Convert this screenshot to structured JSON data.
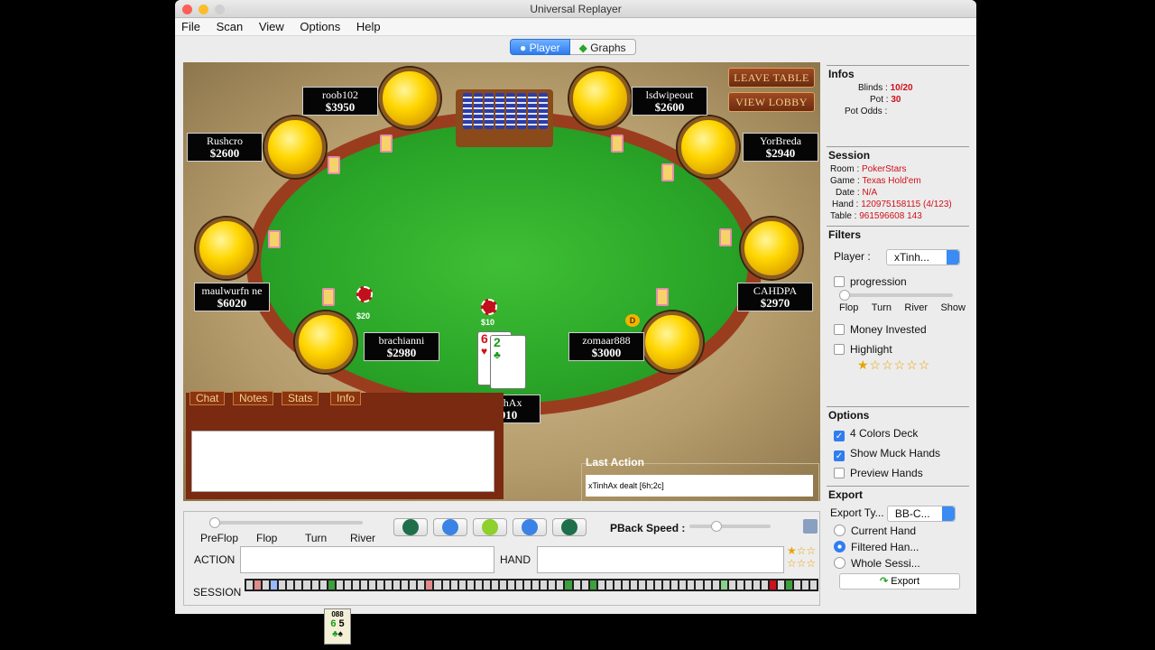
{
  "window": {
    "title": "Universal Replayer"
  },
  "menu": [
    "File",
    "Scan",
    "View",
    "Options",
    "Help"
  ],
  "tabs": [
    {
      "label": "Player",
      "active": true
    },
    {
      "label": "Graphs",
      "active": false
    }
  ],
  "table_buttons": {
    "leave": "LEAVE TABLE",
    "lobby": "VIEW LOBBY"
  },
  "players": [
    {
      "name": "roob102",
      "stack": "$3950"
    },
    {
      "name": "lsdwipeout",
      "stack": "$2600"
    },
    {
      "name": "Rushcro",
      "stack": "$2600"
    },
    {
      "name": "YorBreda",
      "stack": "$2940"
    },
    {
      "name": "maulwurfn ne",
      "stack": "$6020"
    },
    {
      "name": "CAHDPA",
      "stack": "$2970"
    },
    {
      "name": "brachianni",
      "stack": "$2980"
    },
    {
      "name": "zomaar888",
      "stack": "$3000"
    },
    {
      "name": "xTinhAx",
      "stack": "$2910"
    }
  ],
  "bets": {
    "left": "$20",
    "center": "$10"
  },
  "dealer_button": "D",
  "hole_cards": {
    "card1_rank": "6",
    "card1_suit": "♥",
    "card2_rank": "2",
    "card2_suit": "♣"
  },
  "chat_tabs": [
    "Chat",
    "Notes",
    "Stats",
    "Info"
  ],
  "last_action": {
    "title": "Last Action",
    "text": "xTinhAx dealt [6h;2c]"
  },
  "infos": {
    "title": "Infos",
    "blinds_label": "Blinds :",
    "blinds": "10/20",
    "pot_label": "Pot :",
    "pot": "30",
    "pot_odds_label": "Pot Odds :"
  },
  "session": {
    "title": "Session",
    "room_label": "Room :",
    "room": "PokerStars",
    "game_label": "Game :",
    "game": "Texas Hold'em",
    "date_label": "Date :",
    "date": "N/A",
    "hand_label": "Hand :",
    "hand": "120975158115 (4/123)",
    "table_label": "Table :",
    "table": "961596608 143"
  },
  "filters": {
    "title": "Filters",
    "player_label": "Player :",
    "player_value": "xTinh...",
    "progression": "progression",
    "streets": [
      "Flop",
      "Turn",
      "River",
      "Show"
    ],
    "money_invested": "Money Invested",
    "highlight": "Highlight",
    "stars_filled": 1,
    "stars_total": 6
  },
  "options": {
    "title": "Options",
    "colors_deck": "4 Colors Deck",
    "show_muck": "Show Muck Hands",
    "preview": "Preview Hands"
  },
  "export": {
    "title": "Export",
    "type_label": "Export Ty...",
    "type_value": "BB-C...",
    "current": "Current Hand",
    "filtered": "Filtered Han...",
    "whole": "Whole Sessi...",
    "button": "Export"
  },
  "controls": {
    "streets": [
      "PreFlop",
      "Flop",
      "Turn",
      "River"
    ],
    "pback_label": "PBack Speed :",
    "action_label": "ACTION",
    "hand_label": "HAND",
    "session_label": "SESSION"
  },
  "dock_card": {
    "label": "088",
    "rank1": "6",
    "rank2": "5"
  },
  "colors": {
    "felt": "#2aa528",
    "rim": "#9a3d1e",
    "accent": "#2f7df1",
    "red_value": "#d0101a"
  }
}
